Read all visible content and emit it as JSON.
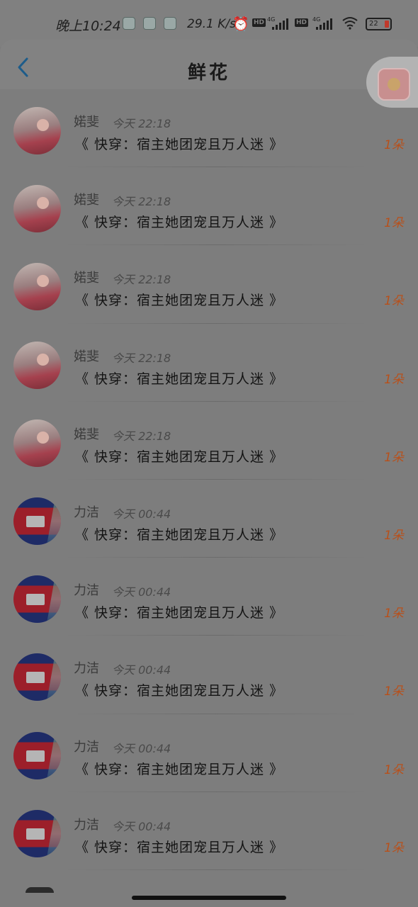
{
  "status_bar": {
    "time": "晚上10:24",
    "speed": "29.1 K/s",
    "network_badge": "HD",
    "network_type": "4G",
    "battery": "22"
  },
  "header": {
    "title": "鲜花"
  },
  "rows": [
    {
      "name": "婼斐",
      "time": "今天 22:18",
      "book": "《 快穿：宿主她团宠且万人迷 》",
      "count": "1朵"
    },
    {
      "name": "婼斐",
      "time": "今天 22:18",
      "book": "《 快穿：宿主她团宠且万人迷 》",
      "count": "1朵"
    },
    {
      "name": "婼斐",
      "time": "今天 22:18",
      "book": "《 快穿：宿主她团宠且万人迷 》",
      "count": "1朵"
    },
    {
      "name": "婼斐",
      "time": "今天 22:18",
      "book": "《 快穿：宿主她团宠且万人迷 》",
      "count": "1朵"
    },
    {
      "name": "婼斐",
      "time": "今天 22:18",
      "book": "《 快穿：宿主她团宠且万人迷 》",
      "count": "1朵"
    },
    {
      "name": "力洁",
      "time": "今天 00:44",
      "book": "《 快穿：宿主她团宠且万人迷 》",
      "count": "1朵"
    },
    {
      "name": "力洁",
      "time": "今天 00:44",
      "book": "《 快穿：宿主她团宠且万人迷 》",
      "count": "1朵"
    },
    {
      "name": "力洁",
      "time": "今天 00:44",
      "book": "《 快穿：宿主她团宠且万人迷 》",
      "count": "1朵"
    },
    {
      "name": "力洁",
      "time": "今天 00:44",
      "book": "《 快穿：宿主她团宠且万人迷 》",
      "count": "1朵"
    },
    {
      "name": "力洁",
      "time": "今天 00:44",
      "book": "《 快穿：宿主她团宠且万人迷 》",
      "count": "1朵"
    }
  ]
}
